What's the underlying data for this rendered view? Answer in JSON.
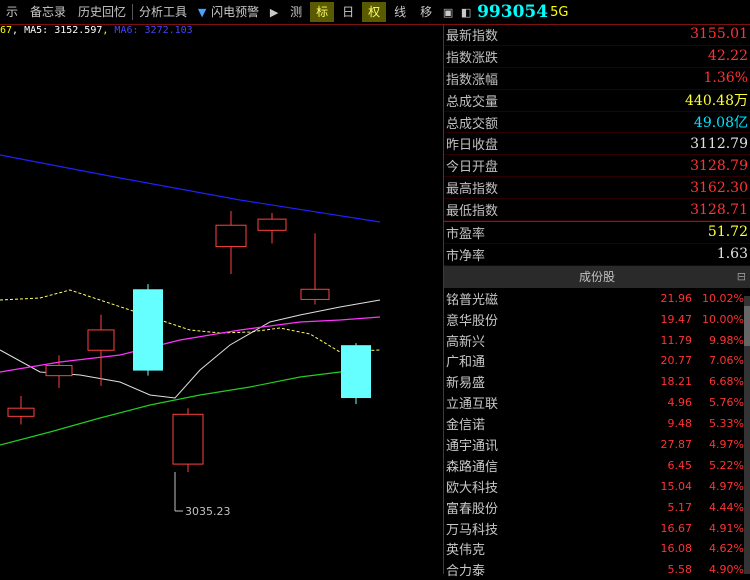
{
  "toolbar": {
    "items": [
      "示",
      "备忘录",
      "历史回忆",
      "分析工具"
    ],
    "alert_label": "闪电预警",
    "buttons": [
      "测",
      "标",
      "日",
      "权",
      "线",
      "移"
    ],
    "stock_code": "993054",
    "stock_suffix": "5G"
  },
  "ma_legend": {
    "part1": "67",
    "part2": "MA5: 3152.597",
    "part3": "MA6: 3272.103"
  },
  "chart_data": {
    "type": "candlestick",
    "low_label": "3035.23",
    "candles": [
      {
        "open": 3090,
        "close": 3098,
        "high": 3110,
        "low": 3082,
        "color": "red"
      },
      {
        "open": 3140,
        "close": 3130,
        "high": 3150,
        "low": 3118,
        "color": "red"
      },
      {
        "open": 3175,
        "close": 3155,
        "high": 3190,
        "low": 3120,
        "color": "red"
      },
      {
        "open": 3135,
        "close": 3215,
        "high": 3220,
        "low": 3130,
        "color": "cyan"
      },
      {
        "open": 3043,
        "close": 3092,
        "high": 3098,
        "low": 3035.23,
        "color": "red"
      },
      {
        "open": 3257,
        "close": 3278,
        "high": 3292,
        "low": 3230,
        "color": "red"
      },
      {
        "open": 3273,
        "close": 3284,
        "high": 3290,
        "low": 3260,
        "color": "red"
      },
      {
        "open": 3215,
        "close": 3205,
        "high": 3270,
        "low": 3200,
        "color": "red"
      },
      {
        "open": 3108,
        "close": 3160,
        "high": 3162,
        "low": 3102,
        "color": "cyan"
      }
    ]
  },
  "quote": {
    "rows": [
      {
        "label": "最新指数",
        "value": "3155.01",
        "color": "red"
      },
      {
        "label": "指数涨跌",
        "value": "42.22",
        "color": "red"
      },
      {
        "label": "指数涨幅",
        "value": "1.36%",
        "color": "red"
      },
      {
        "label": "总成交量",
        "value": "440.48万",
        "color": "yellow"
      },
      {
        "label": "总成交额",
        "value": "49.08亿",
        "color": "cyan"
      },
      {
        "label": "昨日收盘",
        "value": "3112.79",
        "color": "white"
      },
      {
        "label": "今日开盘",
        "value": "3128.79",
        "color": "red"
      },
      {
        "label": "最高指数",
        "value": "3162.30",
        "color": "red"
      },
      {
        "label": "最低指数",
        "value": "3128.71",
        "color": "red"
      }
    ],
    "extra": [
      {
        "label": "市盈率",
        "value": "51.72",
        "color": "yellow"
      },
      {
        "label": "市净率",
        "value": "1.63",
        "color": "white"
      }
    ]
  },
  "constituents": {
    "title": "成份股",
    "rows": [
      {
        "name": "铭普光磁",
        "price": "21.96",
        "pct": "10.02%"
      },
      {
        "name": "意华股份",
        "price": "19.47",
        "pct": "10.00%"
      },
      {
        "name": "高新兴",
        "price": "11.79",
        "pct": "9.98%"
      },
      {
        "name": "广和通",
        "price": "20.77",
        "pct": "7.06%"
      },
      {
        "name": "新易盛",
        "price": "18.21",
        "pct": "6.68%"
      },
      {
        "name": "立通互联",
        "price": "4.96",
        "pct": "5.76%"
      },
      {
        "name": "金信诺",
        "price": "9.48",
        "pct": "5.33%"
      },
      {
        "name": "通宇通讯",
        "price": "27.87",
        "pct": "4.97%"
      },
      {
        "name": "森路通信",
        "price": "6.45",
        "pct": "5.22%"
      },
      {
        "name": "欧大科技",
        "price": "15.04",
        "pct": "4.97%"
      },
      {
        "name": "富春股份",
        "price": "5.17",
        "pct": "4.44%"
      },
      {
        "name": "万马科技",
        "price": "16.67",
        "pct": "4.91%"
      },
      {
        "name": "英伟克",
        "price": "16.08",
        "pct": "4.62%"
      },
      {
        "name": "合力泰",
        "price": "5.58",
        "pct": "4.90%"
      }
    ]
  }
}
